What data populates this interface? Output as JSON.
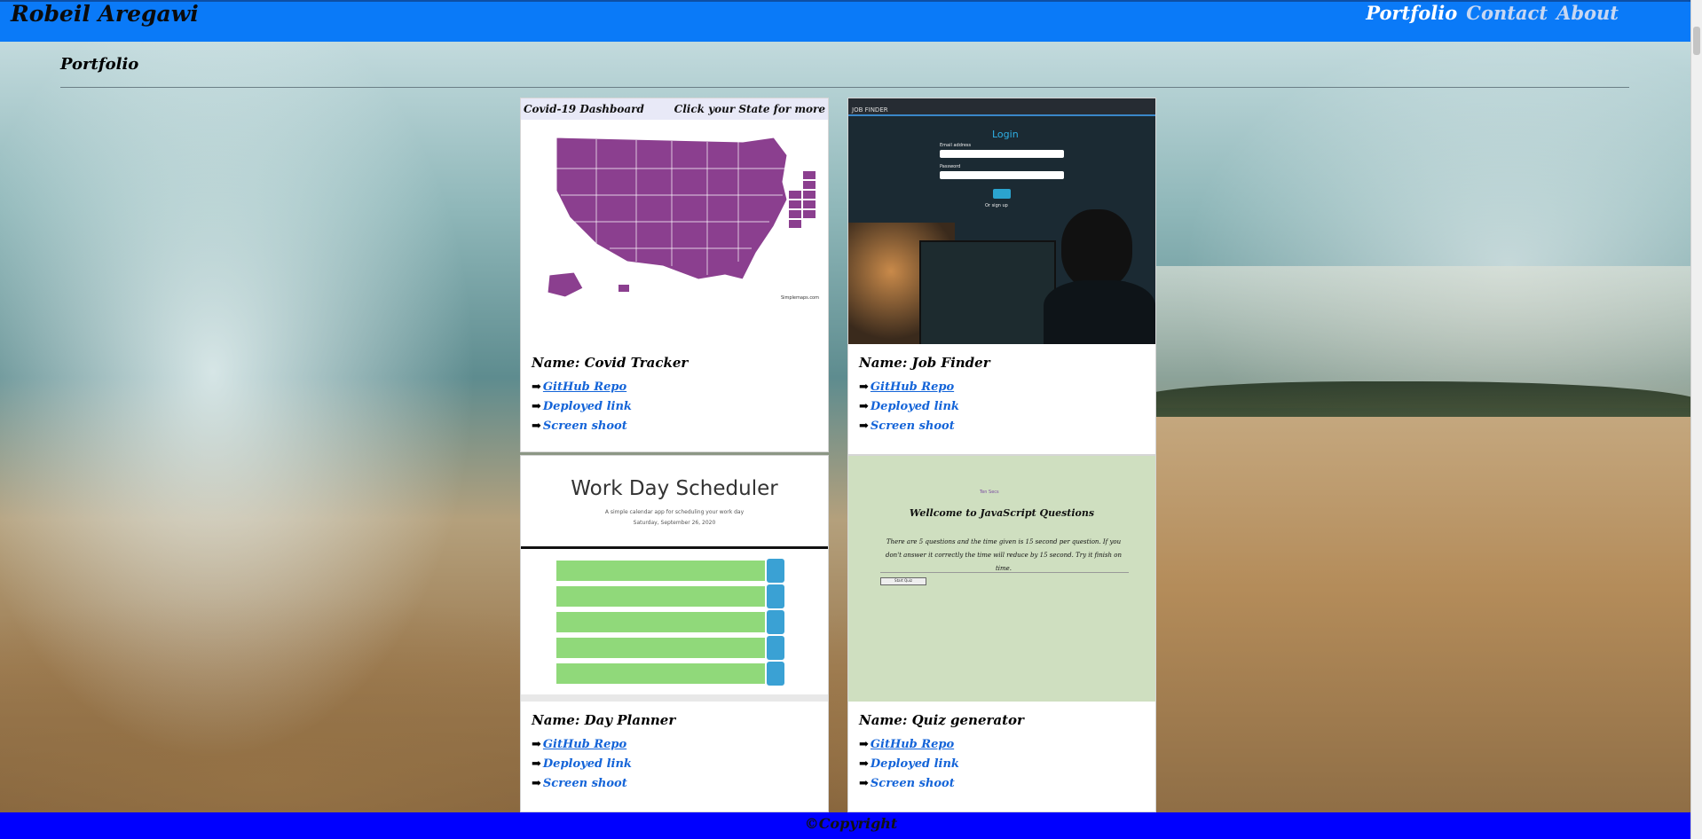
{
  "header": {
    "brand": "Robeil Aregawi",
    "nav": [
      {
        "label": "Portfolio",
        "active": true
      },
      {
        "label": "Contact",
        "active": false
      },
      {
        "label": "About",
        "active": false
      }
    ]
  },
  "page_title": "Portfolio",
  "projects": [
    {
      "name": "Name: Covid Tracker",
      "links": [
        "GitHub Repo",
        "Deployed link",
        "Screen shoot"
      ],
      "screenshot": {
        "left_title": "Covid-19 Dashboard",
        "right_title": "Click your State for more",
        "credit": "Simplemaps.com",
        "map_color": "#8b3f8f"
      }
    },
    {
      "name": "Name: Job Finder",
      "links": [
        "GitHub Repo",
        "Deployed link",
        "Screen shoot"
      ],
      "screenshot": {
        "header": "JOB FINDER",
        "title": "Login",
        "email_label": "Email address",
        "password_label": "Password",
        "or_text": "Or sign up"
      }
    },
    {
      "name": "Name: Day Planner",
      "links": [
        "GitHub Repo",
        "Deployed link",
        "Screen shoot"
      ],
      "screenshot": {
        "title": "Work Day Scheduler",
        "subtitle": "A simple calendar app for scheduling your work day",
        "date": "Saturday, September 26, 2020"
      }
    },
    {
      "name": "Name: Quiz generator",
      "links": [
        "GitHub Repo",
        "Deployed link",
        "Screen shoot"
      ],
      "screenshot": {
        "small_text": "Ten Secs",
        "title": "Wellcome to JavaScript Questions",
        "body": "There are 5 questions and the time given is 15 second per question. If you don't answer it correctly the time will reduce by 15 second. Try it finish on time.",
        "button": "Start Quiz"
      }
    }
  ],
  "footer": "©Copyright",
  "colors": {
    "header_bg": "#0a7af8",
    "footer_bg": "#0000ff",
    "link": "#1464d8"
  }
}
